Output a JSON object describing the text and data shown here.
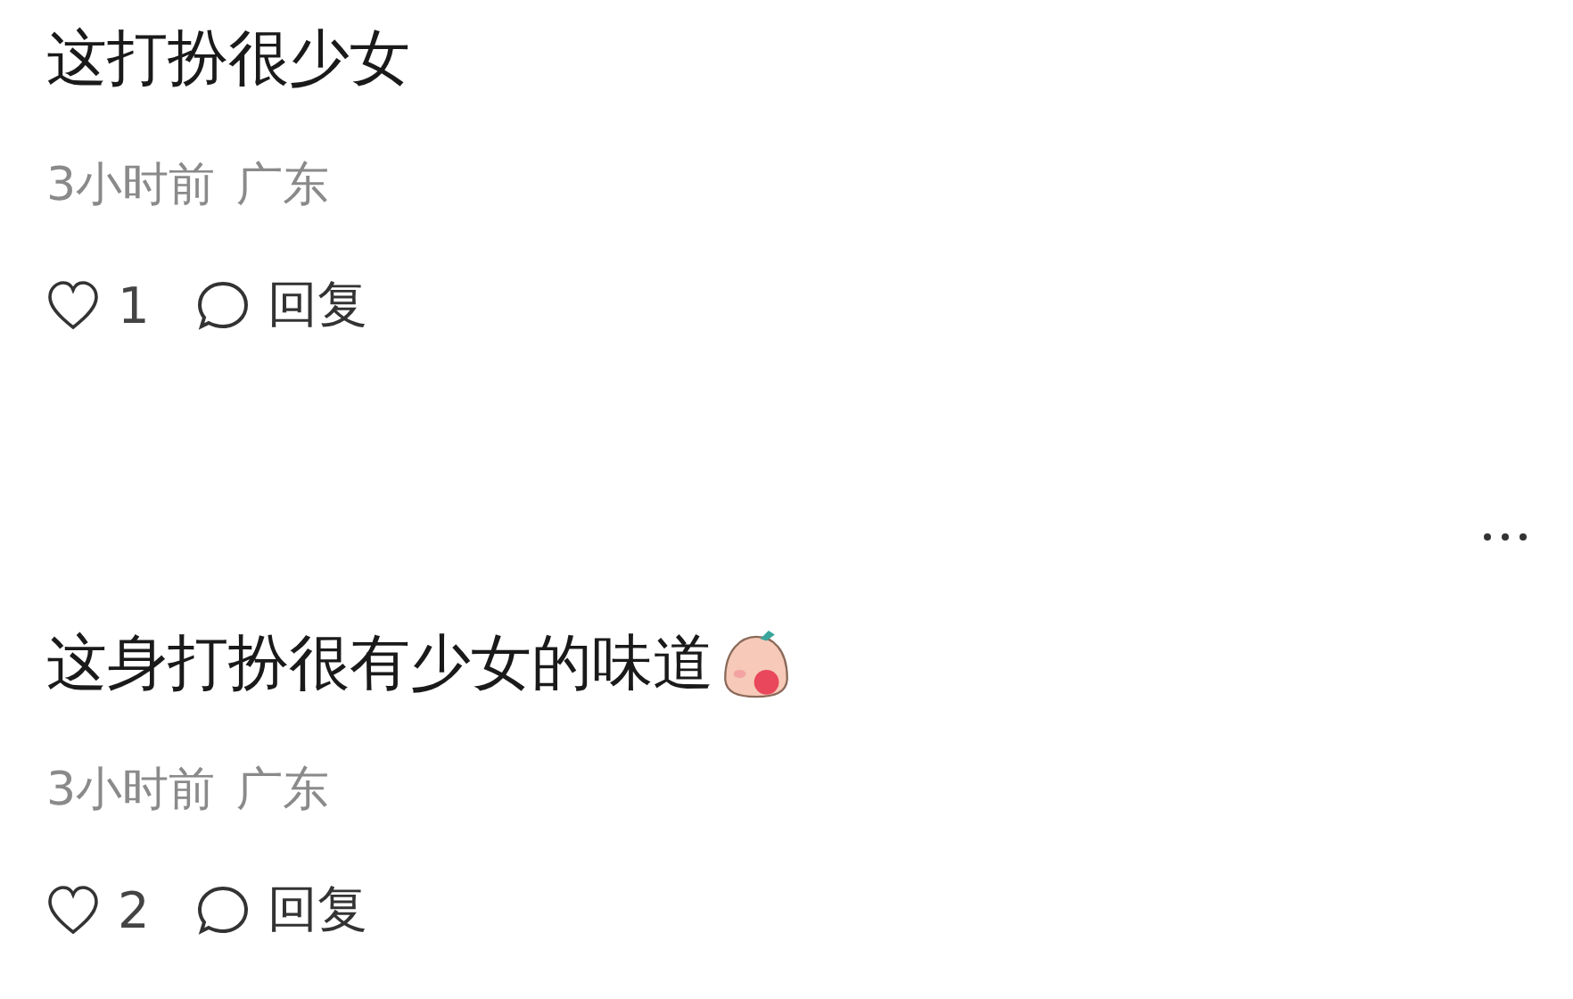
{
  "comments": [
    {
      "text": "这打扮很少女",
      "sticker": false,
      "more_menu": false,
      "time": "3小时前",
      "location": "广东",
      "likes": "1",
      "reply": "回复"
    },
    {
      "text": "这身打扮很有少女的味道",
      "sticker": true,
      "more_menu": true,
      "time": "3小时前",
      "location": "广东",
      "likes": "2",
      "reply": "回复"
    }
  ]
}
